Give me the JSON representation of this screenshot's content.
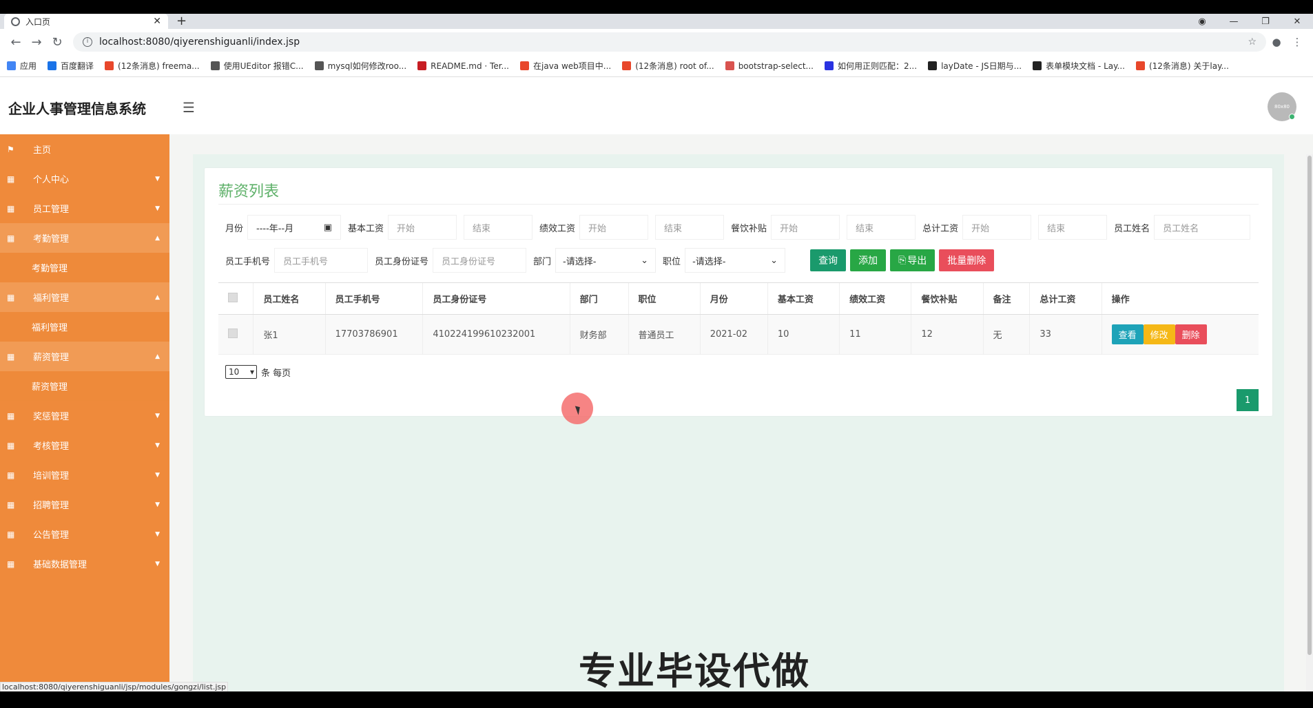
{
  "browser": {
    "tab_title": "入口页",
    "url": "localhost:8080/qiyerenshiguanli/index.jsp",
    "bookmarks": [
      {
        "label": "应用",
        "color": "#4285f4"
      },
      {
        "label": "百度翻译",
        "color": "#1a73e8"
      },
      {
        "label": "(12条消息) freema...",
        "color": "#e8472b"
      },
      {
        "label": "使用UEditor 报错C...",
        "color": "#555"
      },
      {
        "label": "mysql如何修改roo...",
        "color": "#555"
      },
      {
        "label": "README.md · Ter...",
        "color": "#c71d23"
      },
      {
        "label": "在java web项目中...",
        "color": "#e8472b"
      },
      {
        "label": "(12条消息) root of...",
        "color": "#e8472b"
      },
      {
        "label": "bootstrap-select...",
        "color": "#d9534f"
      },
      {
        "label": "如何用正则匹配：2...",
        "color": "#2932e1"
      },
      {
        "label": "layDate - JS日期与...",
        "color": "#222"
      },
      {
        "label": "表单模块文档 - Lay...",
        "color": "#222"
      },
      {
        "label": "(12条消息) 关于lay...",
        "color": "#e8472b"
      }
    ],
    "status_url": "localhost:8080/qiyerenshiguanli/jsp/modules/gongzi/list.jsp"
  },
  "header": {
    "title": "企业人事管理信息系统",
    "avatar_text": "80x80"
  },
  "sidebar": {
    "items": [
      {
        "label": "主页",
        "icon": "flag-icon",
        "type": "top"
      },
      {
        "label": "个人中心",
        "icon": "grid-icon",
        "type": "collapsed"
      },
      {
        "label": "员工管理",
        "icon": "grid-icon",
        "type": "collapsed"
      },
      {
        "label": "考勤管理",
        "icon": "grid-icon",
        "type": "open"
      },
      {
        "label": "考勤管理",
        "type": "sub"
      },
      {
        "label": "福利管理",
        "icon": "grid-icon",
        "type": "open"
      },
      {
        "label": "福利管理",
        "type": "sub"
      },
      {
        "label": "薪资管理",
        "icon": "grid-icon",
        "type": "open"
      },
      {
        "label": "薪资管理",
        "type": "sub"
      },
      {
        "label": "奖惩管理",
        "icon": "grid-icon",
        "type": "collapsed"
      },
      {
        "label": "考核管理",
        "icon": "grid-icon",
        "type": "collapsed"
      },
      {
        "label": "培训管理",
        "icon": "grid-icon",
        "type": "collapsed"
      },
      {
        "label": "招聘管理",
        "icon": "grid-icon",
        "type": "collapsed"
      },
      {
        "label": "公告管理",
        "icon": "grid-icon",
        "type": "collapsed"
      },
      {
        "label": "基础数据管理",
        "icon": "grid-icon",
        "type": "collapsed"
      }
    ]
  },
  "panel": {
    "title": "薪资列表",
    "filters": {
      "month_label": "月份",
      "month_value": "----年--月",
      "base_label": "基本工资",
      "perf_label": "绩效工资",
      "meal_label": "餐饮补贴",
      "total_label": "总计工资",
      "start_ph": "开始",
      "end_ph": "结束",
      "name_label": "员工姓名",
      "name_ph": "员工姓名",
      "phone_label": "员工手机号",
      "phone_ph": "员工手机号",
      "id_label": "员工身份证号",
      "id_ph": "员工身份证号",
      "dept_label": "部门",
      "dept_value": "-请选择-",
      "pos_label": "职位",
      "pos_value": "-请选择-"
    },
    "buttons": {
      "search": "查询",
      "add": "添加",
      "export": "导出",
      "batch_delete": "批量删除"
    },
    "columns": [
      "员工姓名",
      "员工手机号",
      "员工身份证号",
      "部门",
      "职位",
      "月份",
      "基本工资",
      "绩效工资",
      "餐饮补贴",
      "备注",
      "总计工资",
      "操作"
    ],
    "rows": [
      [
        "张1",
        "17703786901",
        "410224199610232001",
        "财务部",
        "普通员工",
        "2021-02",
        "10",
        "11",
        "12",
        "无",
        "33"
      ]
    ],
    "row_actions": {
      "view": "查看",
      "edit": "修改",
      "delete": "删除"
    },
    "page_size": "10",
    "per_page_text": "条 每页",
    "current_page": "1"
  },
  "watermark": "专业毕设代做",
  "colors": {
    "sidebar": "#ef8a3b",
    "title": "#5fb16a",
    "search": "#1a9a6c",
    "add": "#28a745",
    "export": "#28a745",
    "danger": "#e94e5b",
    "view": "#1ea3b8",
    "edit": "#f5b817"
  }
}
